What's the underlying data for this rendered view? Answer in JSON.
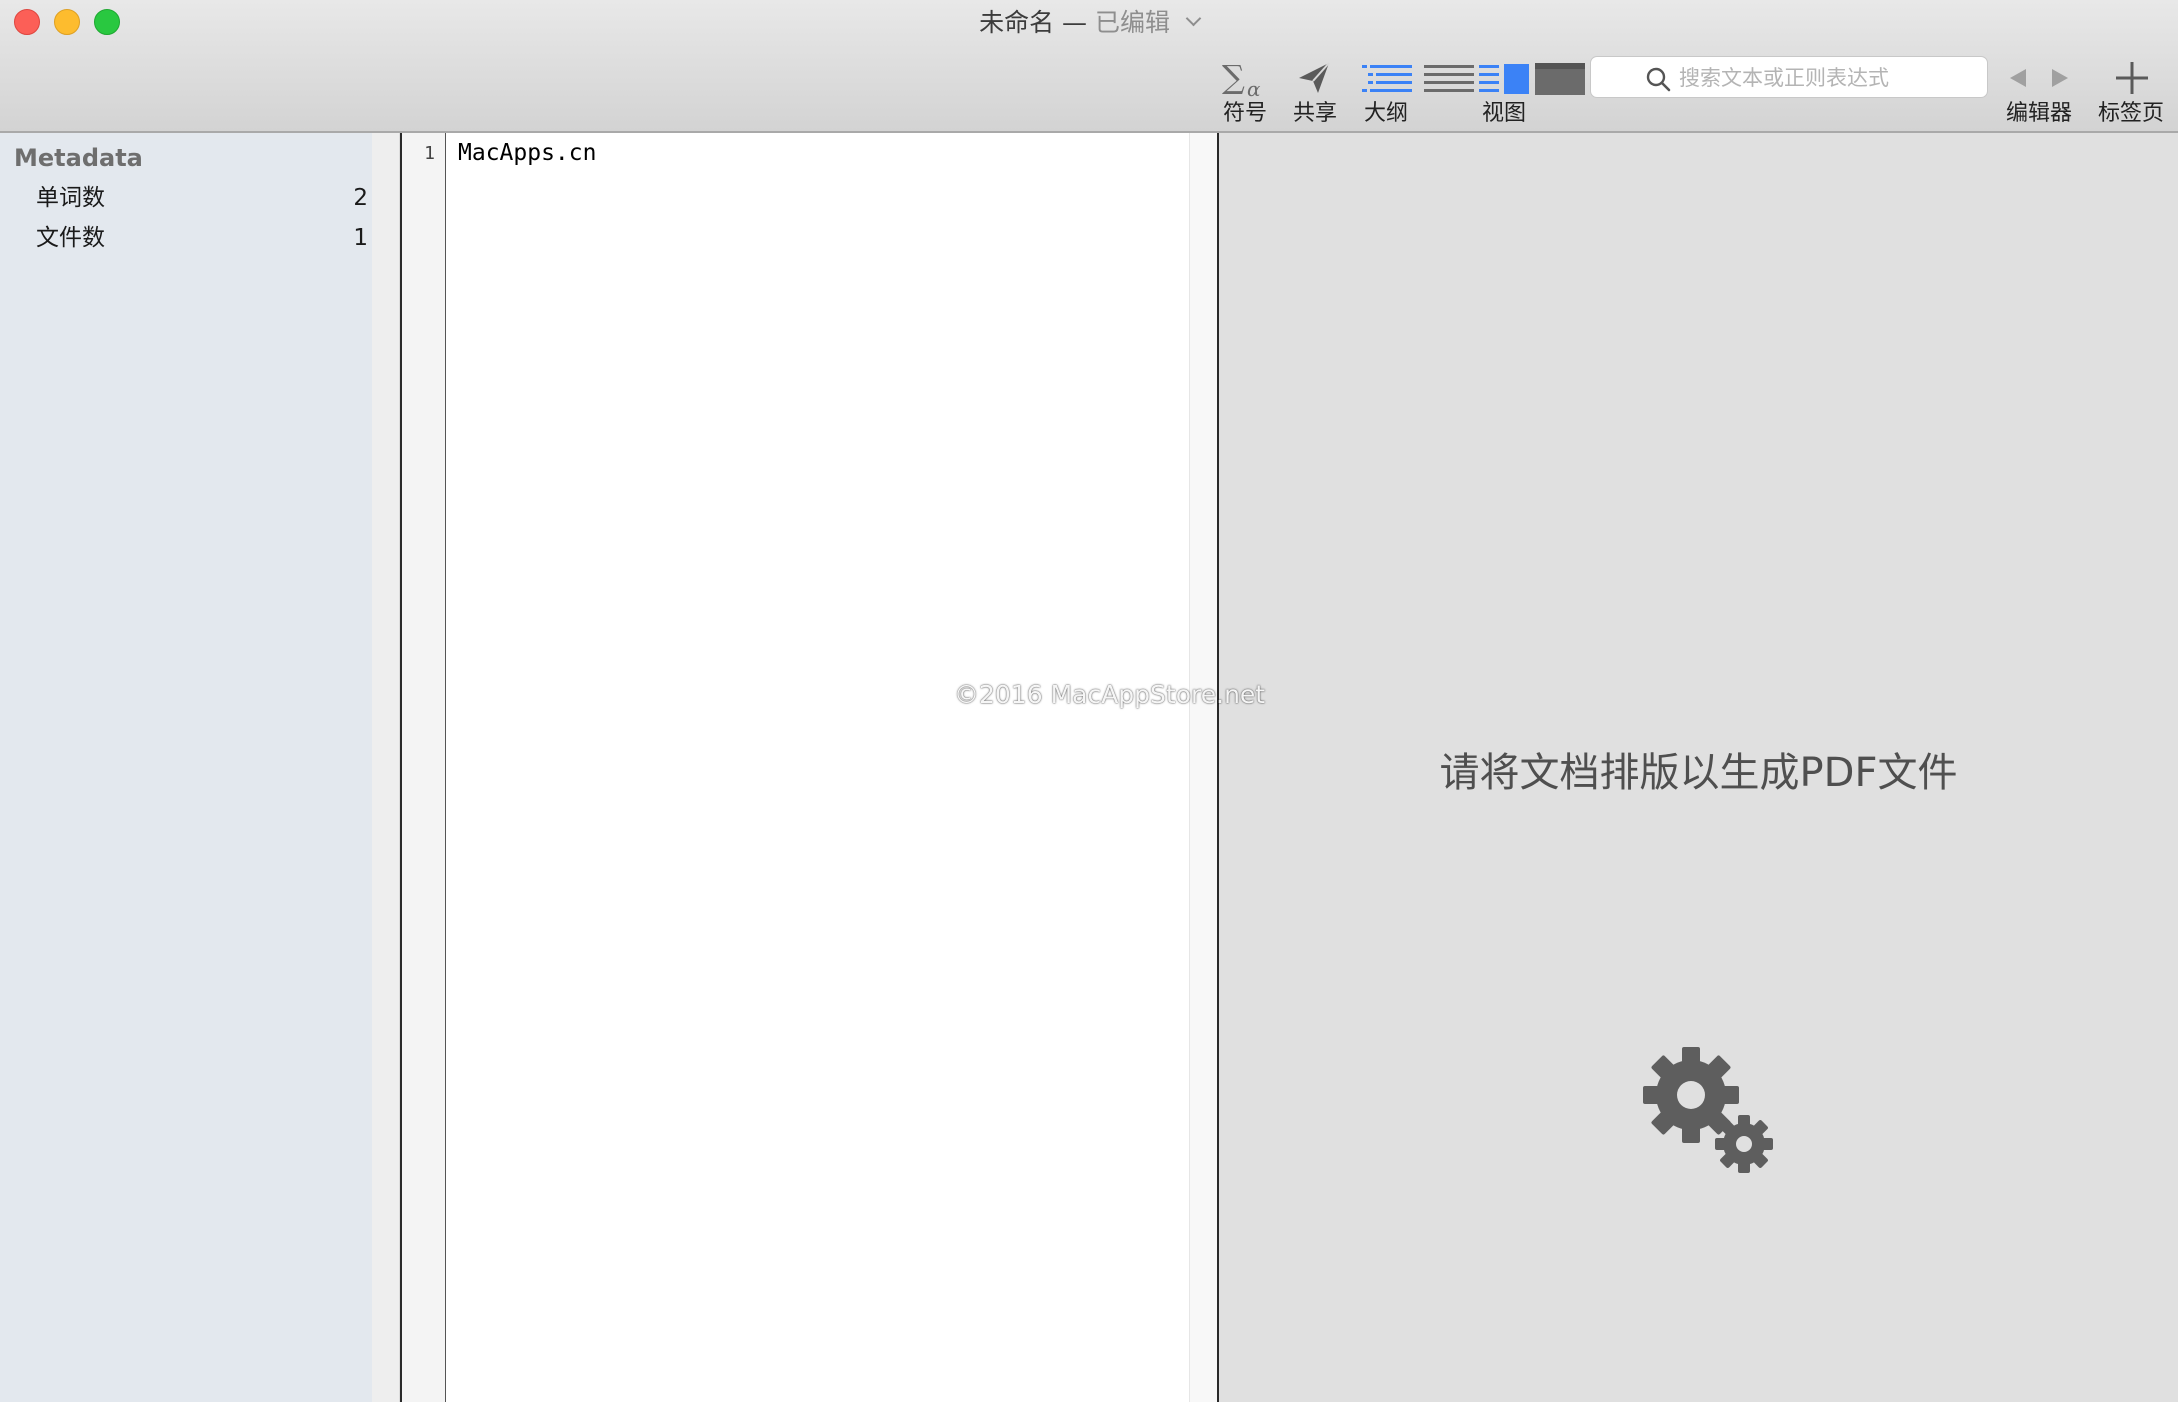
{
  "window": {
    "title": "未命名 —",
    "status": "已编辑"
  },
  "toolbar": {
    "symbols_label": "符号",
    "symbols_icon": "sigma-alpha-icon",
    "share_label": "共享",
    "share_icon": "paper-plane-icon",
    "outline_label": "大纲",
    "outline_icon": "outline-list-icon",
    "view_label": "视图",
    "search_placeholder": "搜索文本或正则表达式",
    "search_value": "",
    "editor_label": "编辑器",
    "new_tab_label": "标签页",
    "accent_color": "#3b82f6"
  },
  "sidebar": {
    "heading": "Metadata",
    "rows": [
      {
        "label": "单词数",
        "count": "2"
      },
      {
        "label": "文件数",
        "count": "1"
      }
    ]
  },
  "editor": {
    "line_number": "1",
    "text": "MacApps.cn"
  },
  "preview": {
    "message": "请将文档排版以生成PDF文件",
    "icon": "gears-icon"
  },
  "watermark": "©2016 MacAppStore.net"
}
